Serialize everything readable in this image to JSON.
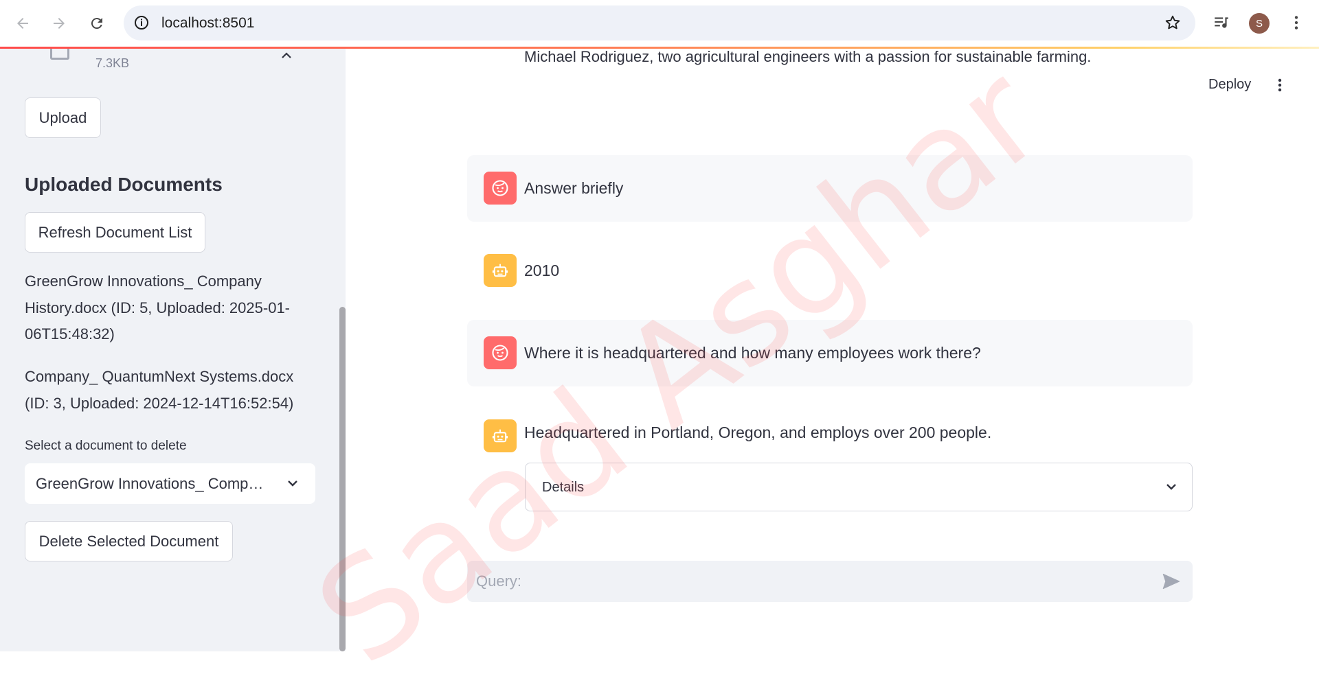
{
  "browser": {
    "url": "localhost:8501",
    "profile_initial": "S"
  },
  "sidebar": {
    "file": {
      "size": "7.3KB"
    },
    "upload_button": "Upload",
    "section_title": "Uploaded Documents",
    "refresh_button": "Refresh Document List",
    "documents": [
      "GreenGrow Innovations_ Company History.docx (ID: 5, Uploaded: 2025-01-06T15:48:32)",
      "Company_ QuantumNext Systems.docx (ID: 3, Uploaded: 2024-12-14T16:52:54)"
    ],
    "select_label": "Select a document to delete",
    "select_value": "GreenGrow Innovations_ Company History.docx",
    "delete_button": "Delete Selected Document"
  },
  "header": {
    "deploy": "Deploy"
  },
  "chat": {
    "partial_text": "Michael Rodriguez, two agricultural engineers with a passion for sustainable farming.",
    "messages": [
      {
        "role": "user",
        "text": "Answer briefly"
      },
      {
        "role": "assistant",
        "text": "2010"
      },
      {
        "role": "user",
        "text": "Where it is headquartered and how many employees work there?"
      },
      {
        "role": "assistant",
        "text": "Headquartered in Portland, Oregon, and employs over 200 people."
      }
    ],
    "details_label": "Details",
    "query_placeholder": "Query:"
  },
  "watermark": "Saad Asghar",
  "colors": {
    "user_avatar": "#ff6b6b",
    "assistant_avatar": "#ffbe45",
    "sidebar_bg": "#f0f2f6"
  },
  "icons": [
    "back-arrow-icon",
    "forward-arrow-icon",
    "reload-icon",
    "info-icon",
    "star-icon",
    "media-control-icon",
    "kebab-menu-icon",
    "file-icon",
    "chevron-up-icon",
    "chevron-down-icon",
    "user-face-icon",
    "robot-icon",
    "send-icon"
  ]
}
